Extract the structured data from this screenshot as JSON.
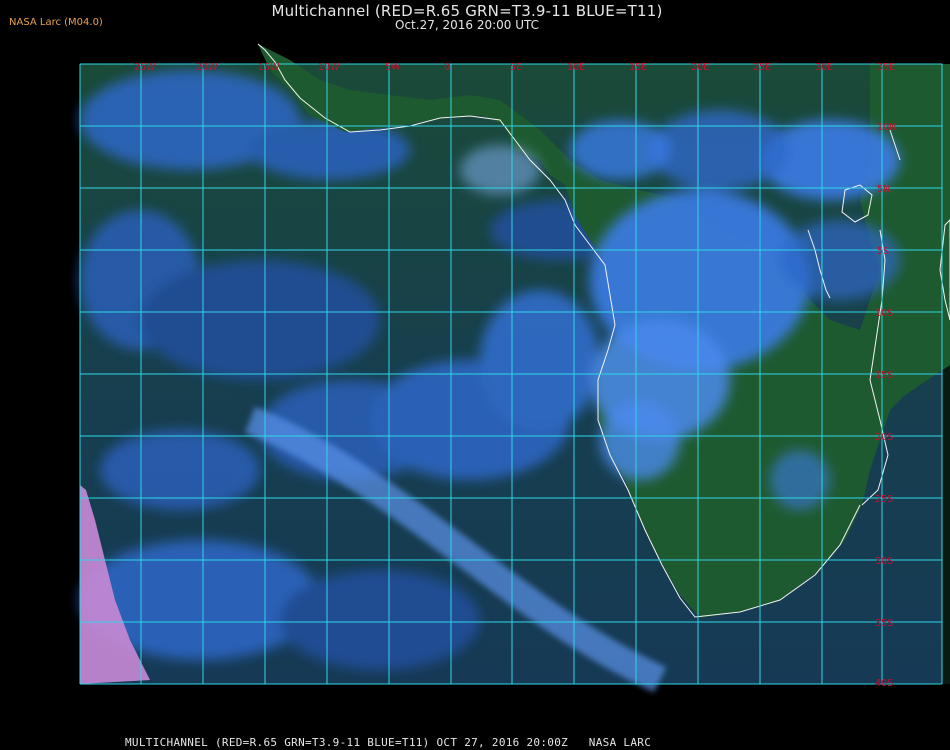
{
  "header": {
    "brand": "NASA Larc (M04.0)",
    "title": "Multichannel (RED=R.65 GRN=T3.9-11 BLUE=T11)",
    "subtitle": "Oct.27, 2016 20:00 UTC"
  },
  "footer": {
    "caption": "MULTICHANNEL (RED=R.65 GRN=T3.9-11 BLUE=T11) OCT 27, 2016 20:00Z   NASA LARC"
  },
  "grid": {
    "line_color": "#2fd7e8",
    "label_color": "#c8102e",
    "longitude_labels": [
      "25W",
      "20W",
      "15W",
      "10W",
      "5W",
      "0",
      "5E",
      "10E",
      "15E",
      "20E",
      "25E",
      "30E",
      "35E"
    ],
    "latitude_labels": [
      "10N",
      "5N",
      "0",
      "5S",
      "10S",
      "15S",
      "20S",
      "25S",
      "30S",
      "35S",
      "40S"
    ]
  },
  "colors": {
    "ocean": "#16443a",
    "land": "#1c4f2c",
    "cloud_blue": "#3a7be6",
    "cloud_light": "#7fb0f0",
    "cloud_pink": "#d78be6",
    "coastline": "#f2f2f2"
  }
}
